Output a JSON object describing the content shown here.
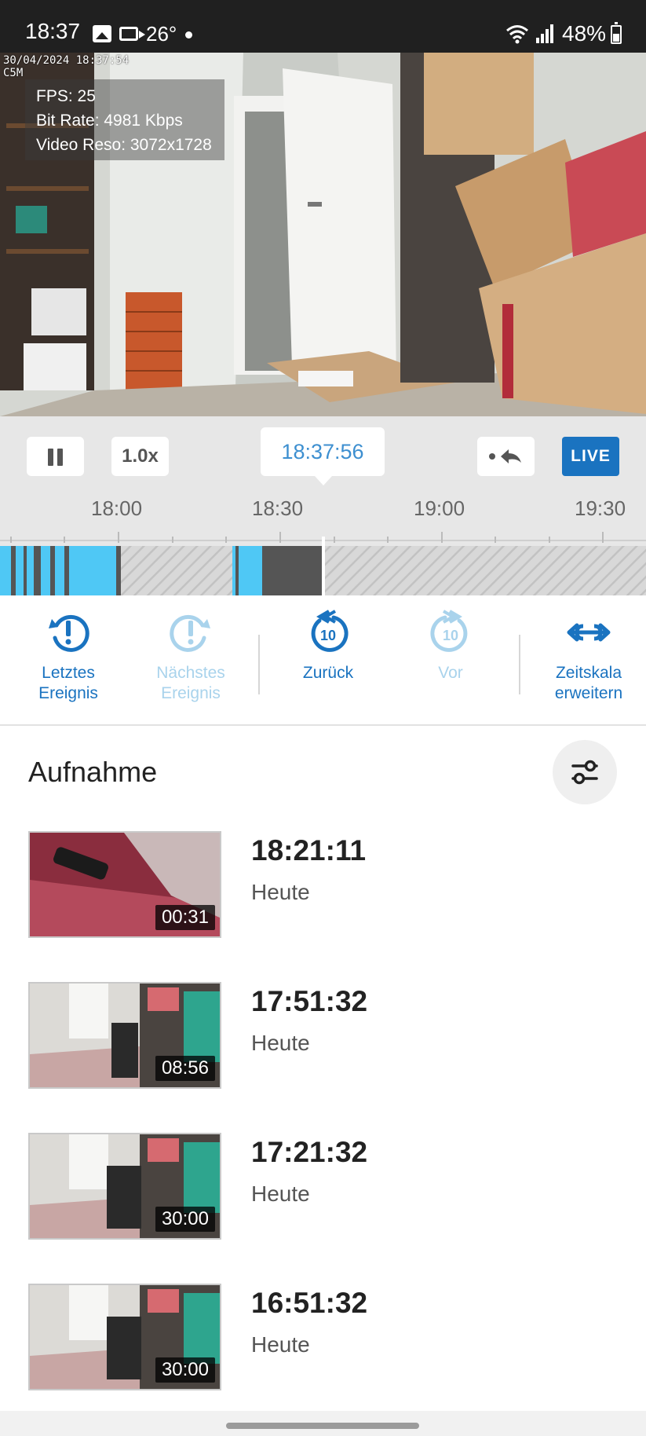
{
  "status_bar": {
    "time": "18:37",
    "temperature": "26°",
    "battery": "48%",
    "icons": [
      "gallery-icon",
      "camera-icon",
      "dot-icon",
      "wifi-icon",
      "signal-icon",
      "battery-icon"
    ]
  },
  "video": {
    "timestamp": "30/04/2024 18:37:54",
    "camera_name": "C5M",
    "stats": {
      "fps": "FPS: 25",
      "bitrate": "Bit Rate: 4981 Kbps",
      "resolution": "Video Reso: 3072x1728"
    }
  },
  "controls": {
    "pause_icon": "pause-icon",
    "speed": "1.0x",
    "current_time": "18:37:56",
    "back_icon": "return-to-live-icon",
    "live": "LIVE"
  },
  "timeline": {
    "ticks": [
      "18:00",
      "18:30",
      "19:00",
      "19:30"
    ],
    "colors": {
      "event": "#4fc8f5",
      "recording": "#555555",
      "empty": "#d4d4d4",
      "playhead": "#ffffff"
    }
  },
  "actions": [
    {
      "label_line1": "Letztes",
      "label_line2": "Ereignis",
      "icon": "previous-event-icon",
      "state": "active"
    },
    {
      "label_line1": "Nächstes",
      "label_line2": "Ereignis",
      "icon": "next-event-icon",
      "state": "disabled"
    },
    {
      "label_line1": "Zurück",
      "label_line2": "",
      "icon": "rewind-10-icon",
      "state": "active"
    },
    {
      "label_line1": "Vor",
      "label_line2": "",
      "icon": "forward-10-icon",
      "state": "disabled"
    },
    {
      "label_line1": "Zeitskala",
      "label_line2": "erweitern",
      "icon": "expand-timeline-icon",
      "state": "active"
    }
  ],
  "recordings": {
    "title": "Aufnahme",
    "filter_icon": "filter-sliders-icon",
    "items": [
      {
        "time": "18:21:11",
        "day": "Heute",
        "duration": "00:31"
      },
      {
        "time": "17:51:32",
        "day": "Heute",
        "duration": "08:56"
      },
      {
        "time": "17:21:32",
        "day": "Heute",
        "duration": "30:00"
      },
      {
        "time": "16:51:32",
        "day": "Heute",
        "duration": "30:00"
      }
    ]
  },
  "colors": {
    "accent": "#1a73c0",
    "accent_light": "#a9d3ec",
    "time_text": "#3d8fd0"
  }
}
